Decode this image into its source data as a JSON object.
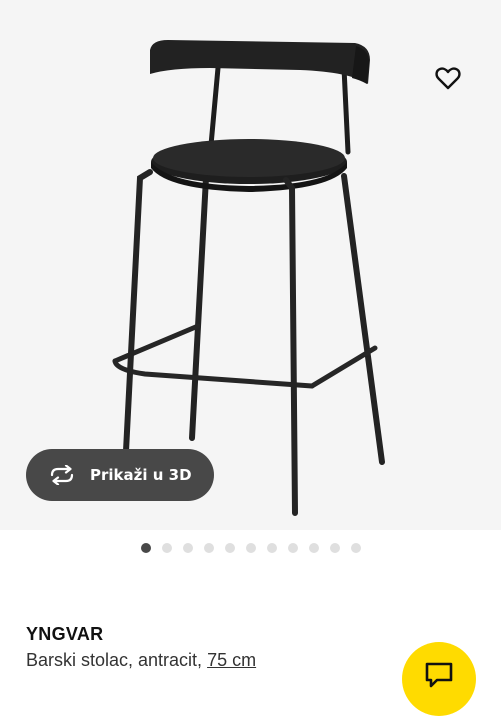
{
  "gallery": {
    "view_3d_label": "Prikaži u 3D",
    "dot_count": 11,
    "active_index": 0
  },
  "product": {
    "name": "YNGVAR",
    "desc_prefix": "Barski stolac, antracit, ",
    "size": "75 cm"
  },
  "icons": {
    "favorite": "heart-icon",
    "view_3d": "rotate-3d-icon",
    "chat": "chat-icon"
  },
  "colors": {
    "chat_fab": "#ffdb00",
    "button_3d": "#484848"
  }
}
